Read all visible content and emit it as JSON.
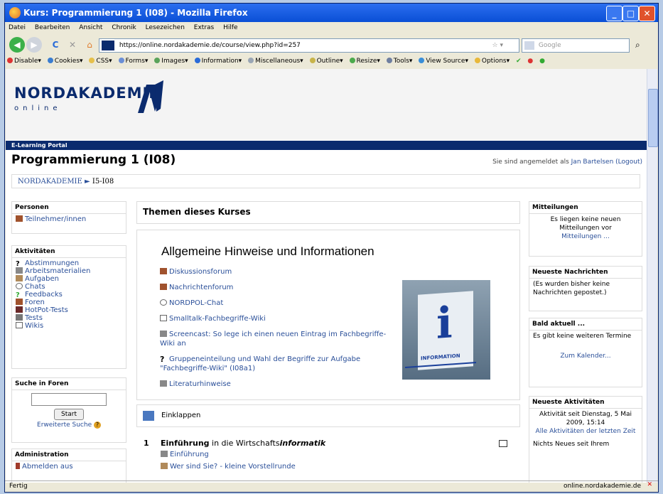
{
  "window": {
    "title": "Kurs: Programmierung 1 (I08) - Mozilla Firefox"
  },
  "menu": [
    "Datei",
    "Bearbeiten",
    "Ansicht",
    "Chronik",
    "Lesezeichen",
    "Extras",
    "Hilfe"
  ],
  "nav": {
    "url": "https://online.nordakademie.de/course/view.php?id=257",
    "search_placeholder": "Google"
  },
  "webdev": [
    {
      "label": "Disable▾",
      "color": "#d33"
    },
    {
      "label": "Cookies▾",
      "color": "#3a7dd0"
    },
    {
      "label": "CSS▾",
      "color": "#e6c04a"
    },
    {
      "label": "Forms▾",
      "color": "#6b8fd6"
    },
    {
      "label": "Images▾",
      "color": "#5aa35a"
    },
    {
      "label": "Information▾",
      "color": "#2a6bd8"
    },
    {
      "label": "Miscellaneous▾",
      "color": "#9aa6b4"
    },
    {
      "label": "Outline▾",
      "color": "#c8b44a"
    },
    {
      "label": "Resize▾",
      "color": "#4caa4c"
    },
    {
      "label": "Tools▾",
      "color": "#6f7fa0"
    },
    {
      "label": "View Source▾",
      "color": "#3a8ed8"
    },
    {
      "label": "Options▾",
      "color": "#e8b83a"
    }
  ],
  "page": {
    "logo": "NORDAKADEMIE",
    "logo_sub": "online",
    "portal_label": "E-Learning Portal",
    "course_title": "Programmierung 1 (I08)",
    "login_prefix": "Sie sind angemeldet als",
    "login_name": "Jan Bartelsen",
    "logout": "(Logout)",
    "breadcrumb": {
      "root": "NORDAKADEMIE",
      "sep": "►",
      "current": "I5-I08"
    }
  },
  "left": {
    "personen": {
      "title": "Personen",
      "items": [
        "Teilnehmer/innen"
      ]
    },
    "aktivitaeten": {
      "title": "Aktivitäten",
      "items": [
        "Abstimmungen",
        "Arbeitsmaterialien",
        "Aufgaben",
        "Chats",
        "Feedbacks",
        "Foren",
        "HotPot-Tests",
        "Tests",
        "Wikis"
      ]
    },
    "suche": {
      "title": "Suche in Foren",
      "button": "Start",
      "advanced": "Erweiterte Suche"
    },
    "admin": {
      "title": "Administration",
      "items": [
        "Abmelden aus"
      ]
    }
  },
  "center": {
    "section_title": "Themen dieses Kurses",
    "general_heading": "Allgemeine Hinweise und Informationen",
    "general_items": [
      "Diskussionsforum",
      "Nachrichtenforum",
      "NORDPOL-Chat",
      "Smalltalk-Fachbegriffe-Wiki",
      "Screencast: So lege ich einen neuen Eintrag im Fachbegriffe-Wiki an",
      "Gruppeneinteilung und Wahl der Begriffe zur Aufgabe \"Fachbegriffe-Wiki\" (I08a1)",
      "Literaturhinweise"
    ],
    "info_image_text": "INFORMATION",
    "collapse": "Einklappen",
    "topic1": {
      "num": "1",
      "title_bold": "Einführung",
      "title_rest": " in die Wirtschafts",
      "title_italic": "informatik",
      "items": [
        "Einführung",
        "Wer sind Sie? - kleine Vorstellrunde"
      ]
    }
  },
  "right": {
    "mitteilungen": {
      "title": "Mitteilungen",
      "text": "Es liegen keine neuen Mitteilungen vor",
      "link": "Mitteilungen ..."
    },
    "nachrichten": {
      "title": "Neueste Nachrichten",
      "text": "(Es wurden bisher keine Nachrichten gepostet.)"
    },
    "bald": {
      "title": "Bald aktuell ...",
      "text": "Es gibt keine weiteren Termine",
      "link": "Zum Kalender..."
    },
    "aktivitaeten": {
      "title": "Neueste Aktivitäten",
      "text": "Aktivität seit Dienstag, 5 Mai 2009, 15:14",
      "link": "Alle Aktivitäten der letzten Zeit",
      "more": "Nichts Neues seit Ihrem"
    }
  },
  "status": {
    "left": "Fertig",
    "right": "online.nordakademie.de"
  }
}
